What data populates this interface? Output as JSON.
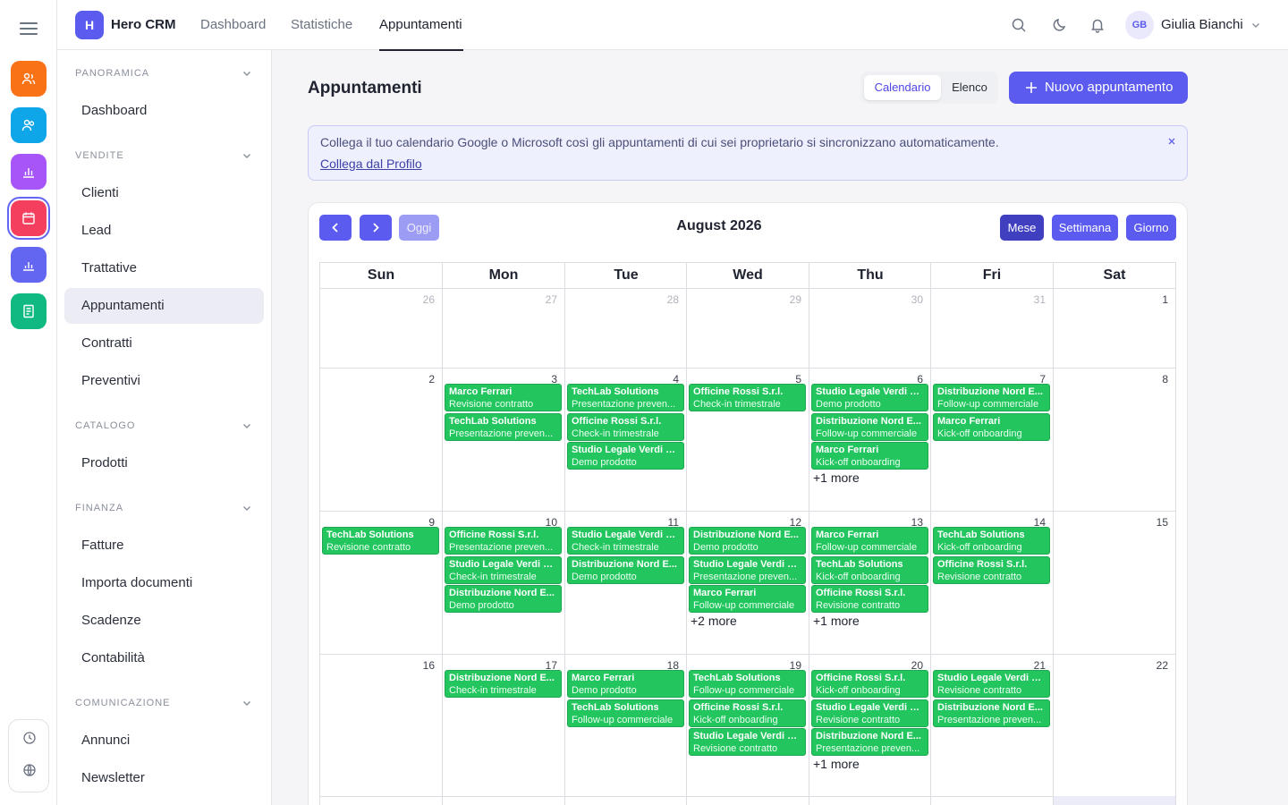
{
  "app": {
    "logo_letter": "H",
    "name": "Hero CRM"
  },
  "topnav": [
    {
      "label": "Dashboard"
    },
    {
      "label": "Statistiche"
    },
    {
      "label": "Appuntamenti"
    }
  ],
  "user": {
    "initials": "GB",
    "name": "Giulia Bianchi"
  },
  "sidebar": {
    "sections": [
      {
        "title": "PANORAMICA",
        "items": [
          "Dashboard"
        ]
      },
      {
        "title": "VENDITE",
        "items": [
          "Clienti",
          "Lead",
          "Trattative",
          "Appuntamenti",
          "Contratti",
          "Preventivi"
        ]
      },
      {
        "title": "CATALOGO",
        "items": [
          "Prodotti"
        ]
      },
      {
        "title": "FINANZA",
        "items": [
          "Fatture",
          "Importa documenti",
          "Scadenze",
          "Contabilità"
        ]
      },
      {
        "title": "COMUNICAZIONE",
        "items": [
          "Annunci",
          "Newsletter"
        ]
      }
    ],
    "active_item": "Appuntamenti"
  },
  "rail": {
    "icons": [
      {
        "name": "contacts-icon",
        "color": "#f97316"
      },
      {
        "name": "users-icon",
        "color": "#0ea5e9"
      },
      {
        "name": "chart-icon",
        "color": "#a855f7"
      },
      {
        "name": "calendar-icon",
        "color": "#f43f5e"
      },
      {
        "name": "stats-icon",
        "color": "#6366f1"
      },
      {
        "name": "document-icon",
        "color": "#10b981"
      }
    ]
  },
  "page": {
    "title": "Appuntamenti",
    "view_toggle": {
      "calendar": "Calendario",
      "list": "Elenco"
    },
    "new_button": "Nuovo appuntamento"
  },
  "banner": {
    "text": "Collega il tuo calendario Google o Microsoft così gli appuntamenti di cui sei proprietario si sincronizzano automaticamente.",
    "link": "Collega dal Profilo"
  },
  "calendar": {
    "title": "August 2026",
    "today_label": "Oggi",
    "views": [
      "Mese",
      "Settimana",
      "Giorno"
    ],
    "active_view": "Mese",
    "weekdays": [
      "Sun",
      "Mon",
      "Tue",
      "Wed",
      "Thu",
      "Fri",
      "Sat"
    ],
    "weeks": [
      {
        "days": [
          {
            "n": "26",
            "other": true,
            "events": []
          },
          {
            "n": "27",
            "other": true,
            "events": []
          },
          {
            "n": "28",
            "other": true,
            "events": []
          },
          {
            "n": "29",
            "other": true,
            "events": []
          },
          {
            "n": "30",
            "other": true,
            "events": []
          },
          {
            "n": "31",
            "other": true,
            "events": []
          },
          {
            "n": "1",
            "events": []
          }
        ]
      },
      {
        "days": [
          {
            "n": "2",
            "events": []
          },
          {
            "n": "3",
            "events": [
              [
                "Marco Ferrari",
                "Revisione contratto"
              ],
              [
                "TechLab Solutions",
                "Presentazione preven..."
              ]
            ]
          },
          {
            "n": "4",
            "events": [
              [
                "TechLab Solutions",
                "Presentazione preven..."
              ],
              [
                "Officine Rossi S.r.l.",
                "Check-in trimestrale"
              ],
              [
                "Studio Legale Verdi &...",
                "Demo prodotto"
              ]
            ]
          },
          {
            "n": "5",
            "events": [
              [
                "Officine Rossi S.r.l.",
                "Check-in trimestrale"
              ]
            ]
          },
          {
            "n": "6",
            "events": [
              [
                "Studio Legale Verdi &...",
                "Demo prodotto"
              ],
              [
                "Distribuzione Nord E...",
                "Follow-up commerciale"
              ],
              [
                "Marco Ferrari",
                "Kick-off onboarding"
              ]
            ],
            "more": "+1 more"
          },
          {
            "n": "7",
            "events": [
              [
                "Distribuzione Nord E...",
                "Follow-up commerciale"
              ],
              [
                "Marco Ferrari",
                "Kick-off onboarding"
              ]
            ]
          },
          {
            "n": "8",
            "events": []
          }
        ]
      },
      {
        "days": [
          {
            "n": "9",
            "events": [
              [
                "TechLab Solutions",
                "Revisione contratto"
              ]
            ]
          },
          {
            "n": "10",
            "events": [
              [
                "Officine Rossi S.r.l.",
                "Presentazione preven..."
              ],
              [
                "Studio Legale Verdi &...",
                "Check-in trimestrale"
              ],
              [
                "Distribuzione Nord E...",
                "Demo prodotto"
              ]
            ]
          },
          {
            "n": "11",
            "events": [
              [
                "Studio Legale Verdi &...",
                "Check-in trimestrale"
              ],
              [
                "Distribuzione Nord E...",
                "Demo prodotto"
              ]
            ]
          },
          {
            "n": "12",
            "events": [
              [
                "Distribuzione Nord E...",
                "Demo prodotto"
              ],
              [
                "Studio Legale Verdi &...",
                "Presentazione preven..."
              ],
              [
                "Marco Ferrari",
                "Follow-up commerciale"
              ]
            ],
            "more": "+2 more"
          },
          {
            "n": "13",
            "events": [
              [
                "Marco Ferrari",
                "Follow-up commerciale"
              ],
              [
                "TechLab Solutions",
                "Kick-off onboarding"
              ],
              [
                "Officine Rossi S.r.l.",
                "Revisione contratto"
              ]
            ],
            "more": "+1 more"
          },
          {
            "n": "14",
            "events": [
              [
                "TechLab Solutions",
                "Kick-off onboarding"
              ],
              [
                "Officine Rossi S.r.l.",
                "Revisione contratto"
              ]
            ]
          },
          {
            "n": "15",
            "events": []
          }
        ]
      },
      {
        "days": [
          {
            "n": "16",
            "events": []
          },
          {
            "n": "17",
            "events": [
              [
                "Distribuzione Nord E...",
                "Check-in trimestrale"
              ]
            ]
          },
          {
            "n": "18",
            "events": [
              [
                "Marco Ferrari",
                "Demo prodotto"
              ],
              [
                "TechLab Solutions",
                "Follow-up commerciale"
              ]
            ]
          },
          {
            "n": "19",
            "events": [
              [
                "TechLab Solutions",
                "Follow-up commerciale"
              ],
              [
                "Officine Rossi S.r.l.",
                "Kick-off onboarding"
              ],
              [
                "Studio Legale Verdi &...",
                "Revisione contratto"
              ]
            ]
          },
          {
            "n": "20",
            "events": [
              [
                "Officine Rossi S.r.l.",
                "Kick-off onboarding"
              ],
              [
                "Studio Legale Verdi &...",
                "Revisione contratto"
              ],
              [
                "Distribuzione Nord E...",
                "Presentazione preven..."
              ]
            ],
            "more": "+1 more"
          },
          {
            "n": "21",
            "events": [
              [
                "Studio Legale Verdi &...",
                "Revisione contratto"
              ],
              [
                "Distribuzione Nord E...",
                "Presentazione preven..."
              ]
            ]
          },
          {
            "n": "22",
            "events": []
          }
        ]
      }
    ]
  }
}
